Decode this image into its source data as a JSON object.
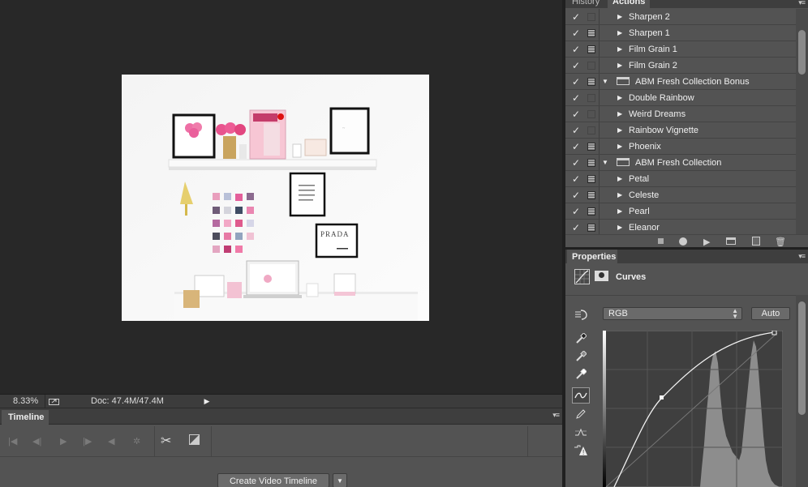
{
  "status": {
    "zoom": "8.33%",
    "doc_size": "Doc: 47.4M/47.4M"
  },
  "timeline": {
    "tab_label": "Timeline",
    "create_button": "Create Video Timeline"
  },
  "actions_panel": {
    "tabs": [
      "History",
      "Actions"
    ],
    "active_tab": "Actions",
    "items": [
      {
        "label": "Sharpen 2",
        "checked": true,
        "dialog": false,
        "type": "action"
      },
      {
        "label": "Sharpen 1",
        "checked": true,
        "dialog": true,
        "type": "action"
      },
      {
        "label": "Film Grain 1",
        "checked": true,
        "dialog": true,
        "type": "action"
      },
      {
        "label": "Film Grain 2",
        "checked": true,
        "dialog": false,
        "type": "action"
      },
      {
        "label": "ABM Fresh Collection Bonus",
        "checked": true,
        "dialog": true,
        "type": "set"
      },
      {
        "label": "Double Rainbow",
        "checked": true,
        "dialog": false,
        "type": "action"
      },
      {
        "label": "Weird Dreams",
        "checked": true,
        "dialog": false,
        "type": "action"
      },
      {
        "label": "Rainbow Vignette",
        "checked": true,
        "dialog": false,
        "type": "action"
      },
      {
        "label": "Phoenix",
        "checked": true,
        "dialog": true,
        "type": "action"
      },
      {
        "label": "ABM Fresh Collection",
        "checked": true,
        "dialog": true,
        "type": "set"
      },
      {
        "label": "Petal",
        "checked": true,
        "dialog": true,
        "type": "action"
      },
      {
        "label": "Celeste",
        "checked": true,
        "dialog": true,
        "type": "action"
      },
      {
        "label": "Pearl",
        "checked": true,
        "dialog": true,
        "type": "action"
      },
      {
        "label": "Eleanor",
        "checked": true,
        "dialog": true,
        "type": "action"
      }
    ],
    "bottom_icons": [
      "stop-icon",
      "record-icon",
      "play-icon",
      "new-set-icon",
      "new-action-icon",
      "trash-icon"
    ]
  },
  "properties": {
    "tab_label": "Properties",
    "adjustment_title": "Curves",
    "channel": "RGB",
    "auto_label": "Auto",
    "tools": [
      "on-image-adjust-icon",
      "black-point-eyedropper-icon",
      "gray-point-eyedropper-icon",
      "white-point-eyedropper-icon",
      "curve-points-icon",
      "pencil-icon",
      "smooth-icon",
      "clipping-warning-icon"
    ]
  },
  "colors": {
    "panel_bg": "#535353",
    "canvas_bg": "#282828",
    "tab_bar": "#3e3e3e"
  }
}
